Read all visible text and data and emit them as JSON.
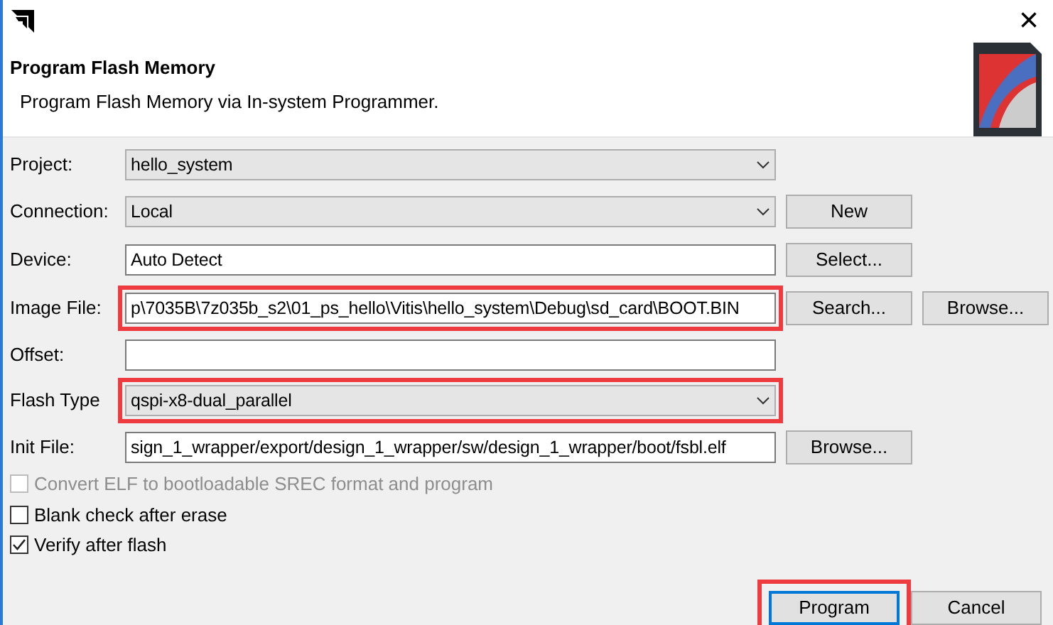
{
  "window": {
    "close": "×"
  },
  "header": {
    "title": "Program Flash Memory",
    "subtitle": "Program Flash Memory via In-system Programmer."
  },
  "fields": [
    {
      "label": "Project:",
      "kind": "combo",
      "value": "hello_system",
      "highlighted": false
    },
    {
      "label": "Connection:",
      "kind": "combo",
      "value": "Local",
      "highlighted": false,
      "buttons": [
        "New"
      ]
    },
    {
      "label": "Device:",
      "kind": "text",
      "value": "Auto Detect",
      "highlighted": false,
      "buttons": [
        "Select..."
      ]
    },
    {
      "label": "Image File:",
      "kind": "text",
      "value": "p\\7035B\\7z035b_s2\\01_ps_hello\\Vitis\\hello_system\\Debug\\sd_card\\BOOT.BIN",
      "highlighted": true,
      "buttons": [
        "Search...",
        "Browse..."
      ]
    },
    {
      "label": "Offset:",
      "kind": "text",
      "highlighted": false
    },
    {
      "label": "Flash Type",
      "kind": "combo",
      "value": "qspi-x8-dual_parallel",
      "highlighted": true
    },
    {
      "label": "Init File:",
      "kind": "text",
      "value": "sign_1_wrapper/export/design_1_wrapper/sw/design_1_wrapper/boot/fsbl.elf",
      "highlighted": false,
      "buttons": [
        "Browse..."
      ]
    }
  ],
  "options": [
    {
      "label": "Convert ELF to bootloadable SREC format and program",
      "checked": false,
      "disabled": true
    },
    {
      "label": "Blank check after erase",
      "checked": false,
      "disabled": false
    },
    {
      "label": "Verify after flash",
      "checked": true,
      "disabled": false
    }
  ],
  "buttons": [
    {
      "label": "Program",
      "default": true,
      "highlighted": true
    },
    {
      "label": "Cancel",
      "default": false,
      "highlighted": false
    }
  ]
}
